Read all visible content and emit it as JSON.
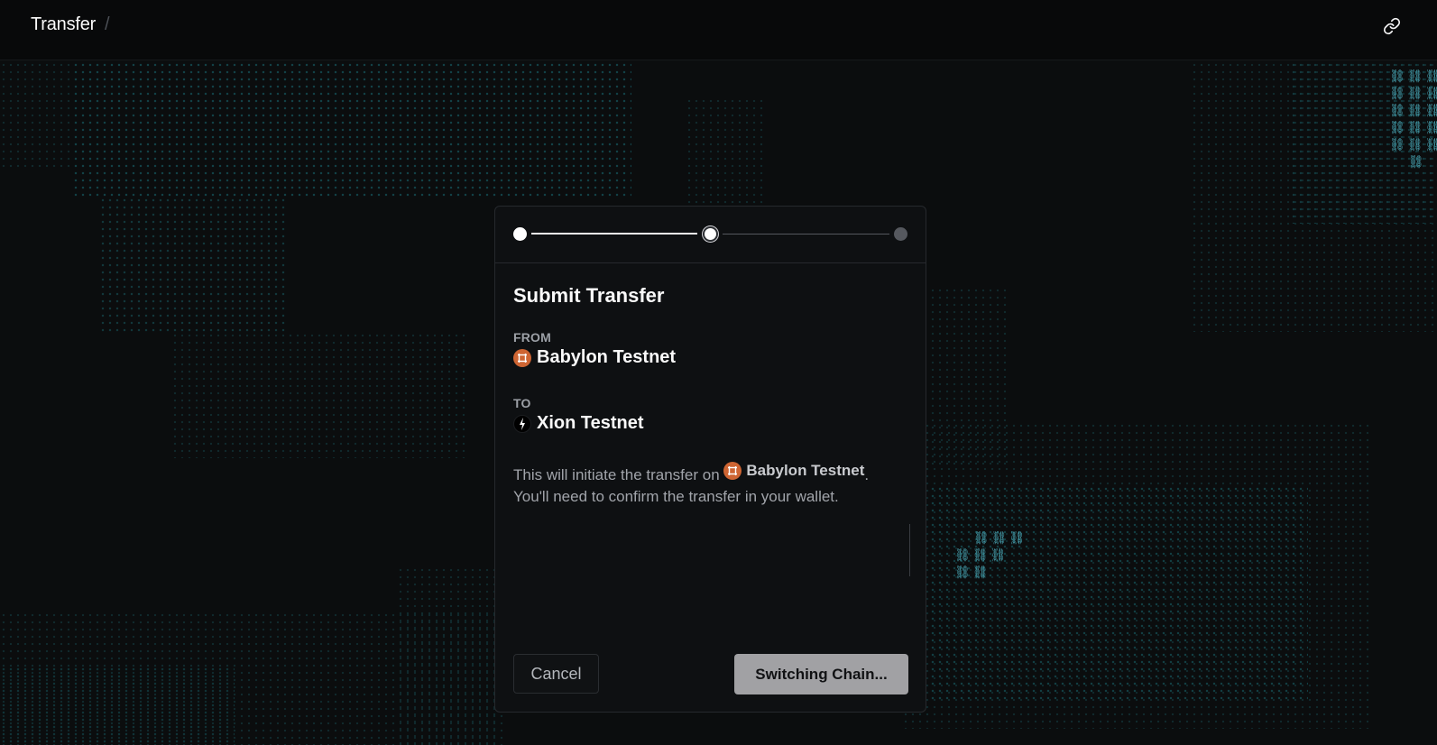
{
  "header": {
    "breadcrumb": "Transfer",
    "separator": "/",
    "link_icon": "link-icon"
  },
  "stepper": {
    "steps": [
      {
        "state": "complete"
      },
      {
        "state": "current"
      },
      {
        "state": "pending"
      }
    ]
  },
  "dialog": {
    "title": "Submit Transfer",
    "from": {
      "label": "FROM",
      "chain": "Babylon Testnet",
      "icon": "babylon-logo-icon"
    },
    "to": {
      "label": "TO",
      "chain": "Xion Testnet",
      "icon": "xion-logo-icon"
    },
    "description": {
      "prefix": "This will initiate the transfer on",
      "chain": "Babylon Testnet",
      "suffix": ".",
      "line2": "You'll need to confirm the transfer in your wallet."
    },
    "cancel_label": "Cancel",
    "primary_label": "Switching Chain..."
  },
  "theme": {
    "background": "#0b0d0e",
    "panel": "#0e1012",
    "accent_dots": "#1e8c96",
    "babylon_orange": "#ce6533",
    "button_disabled": "#a1a1a4"
  }
}
